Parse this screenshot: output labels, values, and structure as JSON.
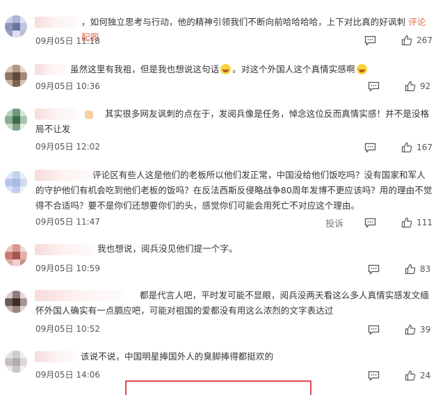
{
  "comments": [
    {
      "text_pre": "，如何独立思考与行动，他的精神引领我们不断向前哈哈哈哈，上下对比真的好讽刺 ",
      "tag": "评论配图",
      "time": "09月05日 11:18",
      "likes": "267",
      "report": ""
    },
    {
      "text_pre": "虽然这里有我祖，但是我也想说这句话",
      "text_mid": "。对这个外国人这个真情实感啊",
      "time": "09月05日 10:36",
      "likes": "92",
      "report": ""
    },
    {
      "text_pre": "其实很多网友讽刺的点在于，发阅兵像是任务，悼念这位反而真情实感！并不是没格局不让发",
      "time": "09月05日 12:02",
      "likes": "167",
      "report": ""
    },
    {
      "text_pre": "评论区有些人这是他们的老板所以他们发正常，中国没给他们饭吃吗？没有国家和军人的守护他们有机会吃到他们老板的饭吗？在反法西斯反侵略战争80周年发博不更应该吗？用的理由不觉得不合适吗？要不是你们还想要你们的头，感觉你们可能会用死亡不对应这个理由。",
      "time": "09月05日 11:47",
      "likes": "111",
      "report": "投诉"
    },
    {
      "text_pre": "我也想说，阅兵没见他们提一个字。",
      "time": "09月05日 10:59",
      "likes": "83",
      "report": ""
    },
    {
      "text_pre": "都是代言人吧，平时发可能不显眼，阅兵没两天看这么多人真情实感发文缅怀外国人确实有一点膈应吧，可能对祖国的爱都没有用这么浓烈的文字表达过",
      "time": "09月05日 10:52",
      "likes": "39",
      "report": ""
    },
    {
      "text_pre": "该说不说，中国明星捧国外人的臭脚捧得都挺欢的",
      "time": "09月05日 14:06",
      "likes": "24",
      "report": ""
    }
  ],
  "colors": {
    "accent": "#e86b4f",
    "highlight_box": "#e04a4a"
  },
  "icons": {
    "comment": "comment-bubble-icon",
    "like": "thumbs-up-icon",
    "emoji": "laughing-tears-emoji"
  }
}
